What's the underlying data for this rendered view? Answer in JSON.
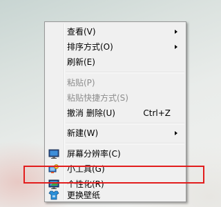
{
  "menu": {
    "items": [
      {
        "label": "查看(V)",
        "submenu": true
      },
      {
        "label": "排序方式(O)",
        "submenu": true
      },
      {
        "label": "刷新(E)"
      },
      {
        "label": "粘贴(P)",
        "disabled": true
      },
      {
        "label": "粘贴快捷方式(S)",
        "disabled": true
      },
      {
        "label": "撤消 删除(U)",
        "shortcut": "Ctrl+Z"
      },
      {
        "label": "新建(W)",
        "submenu": true
      },
      {
        "label": "屏幕分辨率(C)",
        "icon": "screen-resolution-icon"
      },
      {
        "label": "小工具(G)",
        "icon": "gadgets-icon"
      },
      {
        "label": "个性化(R)",
        "icon": "personalize-icon"
      },
      {
        "label": "更换壁纸",
        "icon": "change-wallpaper-icon"
      }
    ]
  },
  "colors": {
    "highlight_box": "#e21c1c",
    "menu_background": "#f0f0f0",
    "disabled_text": "#8d8d8d"
  }
}
